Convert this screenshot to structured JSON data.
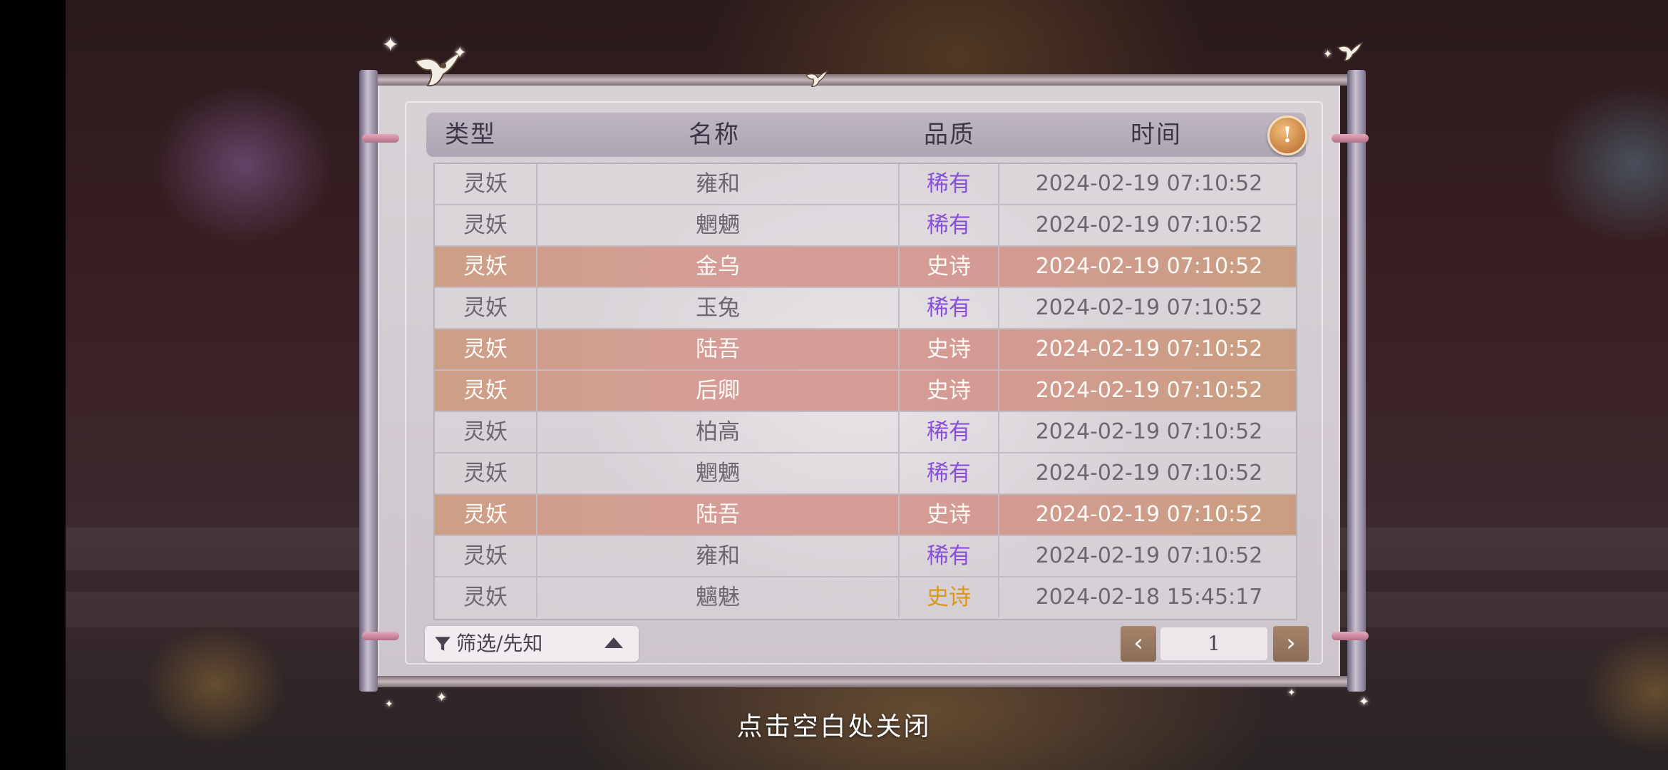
{
  "header": {
    "col_type": "类型",
    "col_name": "名称",
    "col_quality": "品质",
    "col_time": "时间",
    "info_icon": "!"
  },
  "rows": [
    {
      "type": "灵妖",
      "name": "雍和",
      "quality": "稀有",
      "time": "2024-02-19  07:10:52"
    },
    {
      "type": "灵妖",
      "name": "魍魉",
      "quality": "稀有",
      "time": "2024-02-19  07:10:52"
    },
    {
      "type": "灵妖",
      "name": "金乌",
      "quality": "史诗",
      "time": "2024-02-19  07:10:52"
    },
    {
      "type": "灵妖",
      "name": "玉兔",
      "quality": "稀有",
      "time": "2024-02-19  07:10:52"
    },
    {
      "type": "灵妖",
      "name": "陆吾",
      "quality": "史诗",
      "time": "2024-02-19  07:10:52"
    },
    {
      "type": "灵妖",
      "name": "后卿",
      "quality": "史诗",
      "time": "2024-02-19  07:10:52"
    },
    {
      "type": "灵妖",
      "name": "柏高",
      "quality": "稀有",
      "time": "2024-02-19  07:10:52"
    },
    {
      "type": "灵妖",
      "name": "魍魉",
      "quality": "稀有",
      "time": "2024-02-19  07:10:52"
    },
    {
      "type": "灵妖",
      "name": "陆吾",
      "quality": "史诗",
      "time": "2024-02-19  07:10:52"
    },
    {
      "type": "灵妖",
      "name": "雍和",
      "quality": "稀有",
      "time": "2024-02-19  07:10:52"
    },
    {
      "type": "灵妖",
      "name": "魑魅",
      "quality": "史诗",
      "time": "2024-02-18  15:45:17"
    }
  ],
  "filter": {
    "label": "筛选/先知"
  },
  "pagination": {
    "prev": "‹",
    "next": "›",
    "page": "1"
  },
  "close_hint": "点击空白处关闭",
  "colors": {
    "rare": "#8a4fd8",
    "epic_highlight_row": "#d39b93",
    "epic_plain_text": "#d89a1c"
  }
}
